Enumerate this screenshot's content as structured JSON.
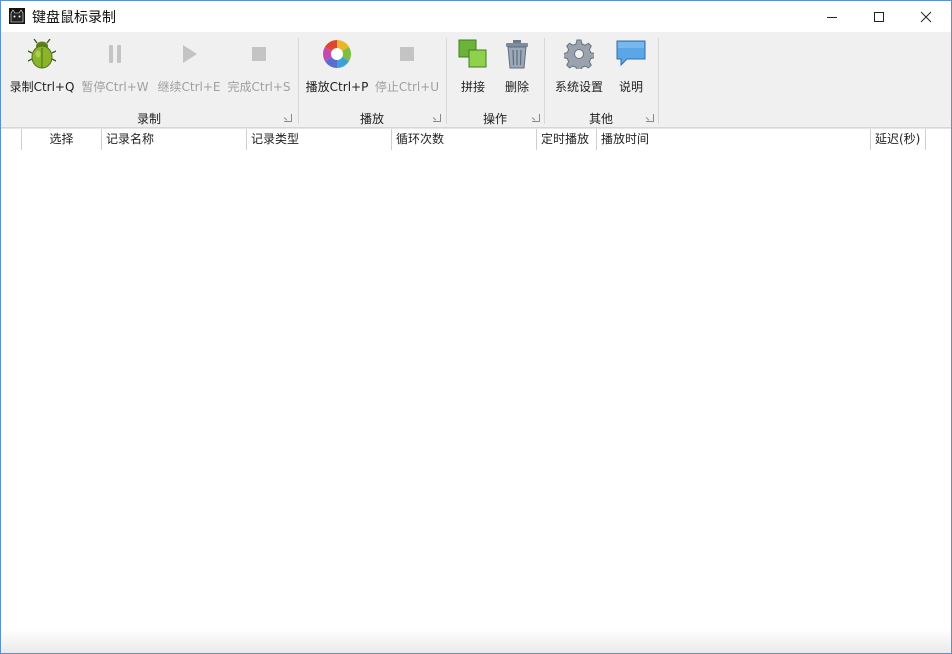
{
  "window": {
    "title": "键盘鼠标录制",
    "icon": "black-cat-icon",
    "controls": [
      "minimize-icon",
      "maximize-icon",
      "close-icon"
    ]
  },
  "ribbon": {
    "groups": [
      {
        "label": "录制",
        "buttons": [
          {
            "label": "录制Ctrl+Q",
            "icon": "green-bug-icon",
            "enabled": true
          },
          {
            "label": "暂停Ctrl+W",
            "icon": "pause-icon",
            "enabled": false
          },
          {
            "label": "继续Ctrl+E",
            "icon": "play-icon",
            "enabled": false
          },
          {
            "label": "完成Ctrl+S",
            "icon": "stop-icon",
            "enabled": false
          }
        ]
      },
      {
        "label": "播放",
        "buttons": [
          {
            "label": "播放Ctrl+P",
            "icon": "color-wheel-icon",
            "enabled": true
          },
          {
            "label": "停止Ctrl+U",
            "icon": "stop-icon",
            "enabled": false
          }
        ]
      },
      {
        "label": "操作",
        "buttons": [
          {
            "label": "拼接",
            "icon": "merge-squares-icon",
            "enabled": true
          },
          {
            "label": "删除",
            "icon": "trash-icon",
            "enabled": true
          }
        ]
      },
      {
        "label": "其他",
        "buttons": [
          {
            "label": "系统设置",
            "icon": "gear-icon",
            "enabled": true
          },
          {
            "label": "说明",
            "icon": "speech-bubble-icon",
            "enabled": true
          }
        ]
      }
    ]
  },
  "table": {
    "columns": [
      "",
      "选择",
      "记录名称",
      "记录类型",
      "循环次数",
      "定时播放",
      "播放时间",
      "延迟(秒)"
    ],
    "rows": []
  },
  "colors": {
    "window_border": "#5b8fd6",
    "ribbon_bg": "#f0f0f0",
    "disabled_text": "#a0a0a0"
  }
}
